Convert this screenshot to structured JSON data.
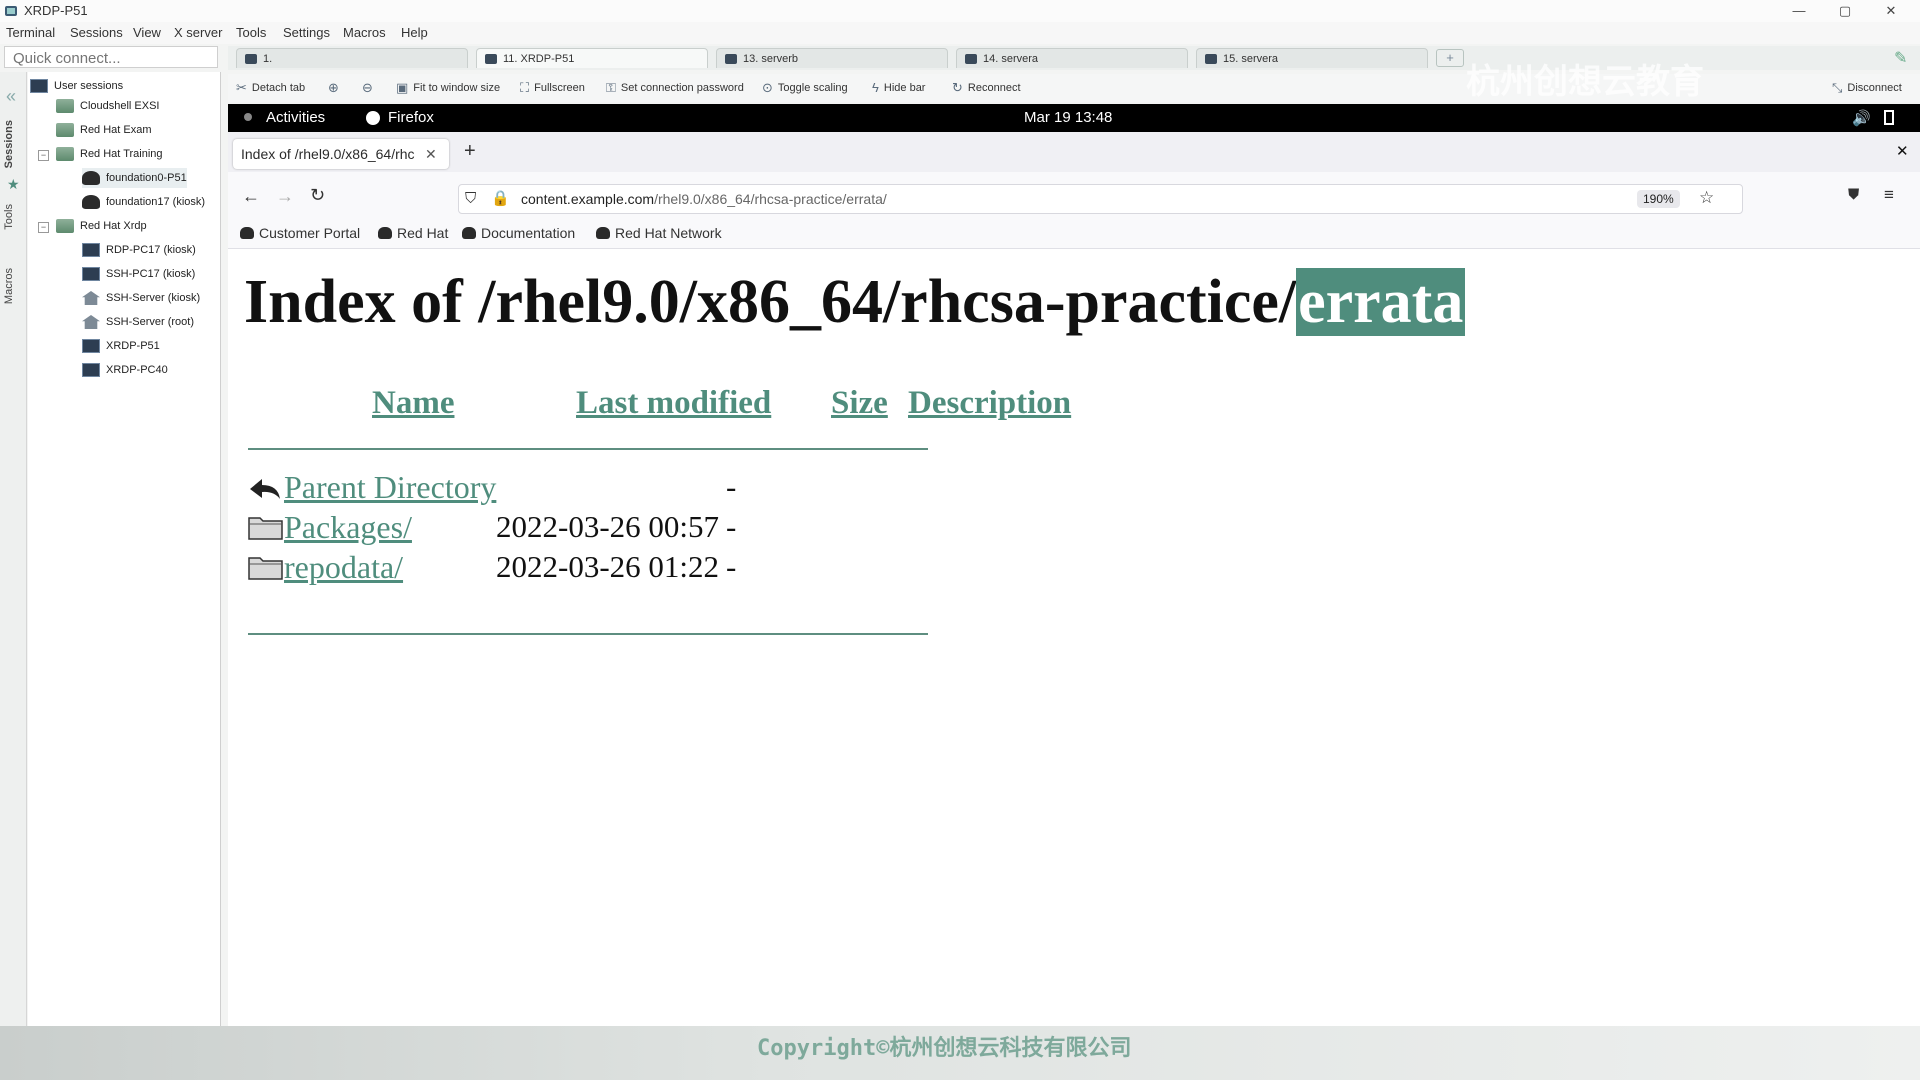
{
  "app": {
    "title": "XRDP-P51"
  },
  "window_controls": {
    "minimize": "—",
    "maximize": "▢",
    "close": "✕"
  },
  "menu": [
    "Terminal",
    "Sessions",
    "View",
    "X server",
    "Tools",
    "Settings",
    "Macros",
    "Help"
  ],
  "quick_connect": {
    "placeholder": "Quick connect..."
  },
  "side_tabs": [
    "Sessions",
    "Tools",
    "Macros"
  ],
  "tree": {
    "root": "User sessions",
    "items": [
      "Cloudshell EXSI",
      "Red Hat Exam",
      "Red Hat Training",
      "foundation0-P51",
      "foundation17 (kiosk)",
      "Red Hat Xrdp",
      "RDP-PC17 (kiosk)",
      "SSH-PC17 (kiosk)",
      "SSH-Server (kiosk)",
      "SSH-Server (root)",
      "XRDP-P51",
      "XRDP-PC40"
    ]
  },
  "session_tabs": [
    "1.",
    "11. XRDP-P51",
    "13. serverb",
    "14. servera",
    "15. servera"
  ],
  "toolbar": [
    "Detach tab",
    "Fit to window size",
    "Fullscreen",
    "Set connection password",
    "Toggle scaling",
    "Hide bar",
    "Reconnect",
    "Disconnect"
  ],
  "gnome": {
    "activities": "Activities",
    "app": "Firefox",
    "clock": "Mar 19  13:48"
  },
  "firefox": {
    "tab_title": "Index of /rhel9.0/x86_64/rhc",
    "url_domain": "content.example.com",
    "url_path": "/rhel9.0/x86_64/rhcsa-practice/errata/",
    "zoom": "190%",
    "bookmarks": [
      "Customer Portal",
      "Red Hat",
      "Documentation",
      "Red Hat Network"
    ]
  },
  "listing": {
    "title_prefix": "Index of /rhel9.0/x86_64/rhcsa-practice/",
    "title_selected": "errata",
    "headers": {
      "name": "Name",
      "modified": "Last modified",
      "size": "Size",
      "description": "Description"
    },
    "rows": [
      {
        "name": "Parent Directory",
        "modified": "",
        "size": "-"
      },
      {
        "name": "Packages/",
        "modified": "2022-03-26 00:57",
        "size": "-"
      },
      {
        "name": "repodata/",
        "modified": "2022-03-26 01:22",
        "size": "-"
      }
    ]
  },
  "watermark": {
    "text": "杭州创想云教育",
    "copyright": "Copyright©杭州创想云科技有限公司"
  },
  "colors": {
    "link": "#4f8d7d",
    "selection": "#4f8d7d",
    "gnome_bar": "#000000"
  }
}
